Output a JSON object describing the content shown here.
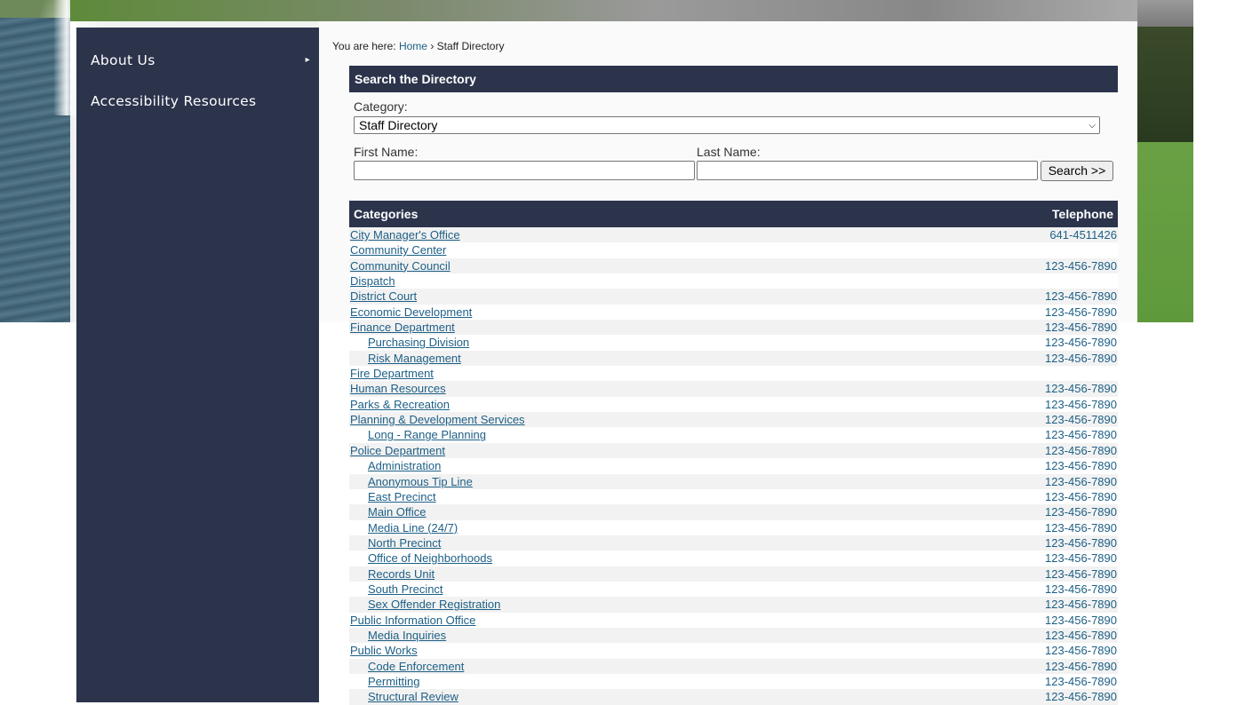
{
  "sidebar": {
    "items": [
      {
        "label": "About Us",
        "arrow": "▸"
      },
      {
        "label": "Accessibility Resources"
      }
    ]
  },
  "breadcrumb": {
    "prefix": "You are here:",
    "home": "Home",
    "separator": "›",
    "current": "Staff Directory"
  },
  "search": {
    "title": "Search the Directory",
    "category_label": "Category:",
    "category_value": "Staff Directory",
    "first_name_label": "First Name:",
    "last_name_label": "Last Name:",
    "button_label": "Search >>"
  },
  "table": {
    "col_categories": "Categories",
    "col_telephone": "Telephone",
    "rows": [
      {
        "name": "City Manager's Office",
        "phone": "641-4511426",
        "sub": false
      },
      {
        "name": "Community Center",
        "phone": "",
        "sub": false
      },
      {
        "name": "Community Council",
        "phone": "123-456-7890",
        "sub": false
      },
      {
        "name": "Dispatch",
        "phone": "",
        "sub": false
      },
      {
        "name": "District Court",
        "phone": "123-456-7890",
        "sub": false
      },
      {
        "name": "Economic Development",
        "phone": "123-456-7890",
        "sub": false
      },
      {
        "name": "Finance Department",
        "phone": "123-456-7890",
        "sub": false
      },
      {
        "name": "Purchasing Division",
        "phone": "123-456-7890",
        "sub": true
      },
      {
        "name": "Risk Management",
        "phone": "123-456-7890",
        "sub": true
      },
      {
        "name": "Fire Department",
        "phone": "",
        "sub": false
      },
      {
        "name": "Human Resources",
        "phone": "123-456-7890",
        "sub": false
      },
      {
        "name": "Parks & Recreation",
        "phone": "123-456-7890",
        "sub": false
      },
      {
        "name": "Planning & Development Services",
        "phone": "123-456-7890",
        "sub": false
      },
      {
        "name": "Long - Range Planning",
        "phone": "123-456-7890",
        "sub": true
      },
      {
        "name": "Police Department",
        "phone": "123-456-7890",
        "sub": false
      },
      {
        "name": "Administration",
        "phone": "123-456-7890",
        "sub": true
      },
      {
        "name": "Anonymous Tip Line",
        "phone": "123-456-7890",
        "sub": true
      },
      {
        "name": "East Precinct",
        "phone": "123-456-7890",
        "sub": true
      },
      {
        "name": "Main Office",
        "phone": "123-456-7890",
        "sub": true
      },
      {
        "name": "Media Line (24/7)",
        "phone": "123-456-7890",
        "sub": true
      },
      {
        "name": "North Precinct",
        "phone": "123-456-7890",
        "sub": true
      },
      {
        "name": "Office of Neighborhoods",
        "phone": "123-456-7890",
        "sub": true
      },
      {
        "name": "Records Unit",
        "phone": "123-456-7890",
        "sub": true
      },
      {
        "name": "South Precinct",
        "phone": "123-456-7890",
        "sub": true
      },
      {
        "name": "Sex Offender Registration",
        "phone": "123-456-7890",
        "sub": true
      },
      {
        "name": "Public Information Office",
        "phone": "123-456-7890",
        "sub": false
      },
      {
        "name": "Media Inquiries",
        "phone": "123-456-7890",
        "sub": true
      },
      {
        "name": "Public Works",
        "phone": "123-456-7890",
        "sub": false
      },
      {
        "name": "Code Enforcement",
        "phone": "123-456-7890",
        "sub": true
      },
      {
        "name": "Permitting",
        "phone": "123-456-7890",
        "sub": true
      },
      {
        "name": "Structural Review",
        "phone": "123-456-7890",
        "sub": true
      }
    ]
  },
  "colors": {
    "navy": "#2c344c",
    "link": "#1d5f86"
  }
}
